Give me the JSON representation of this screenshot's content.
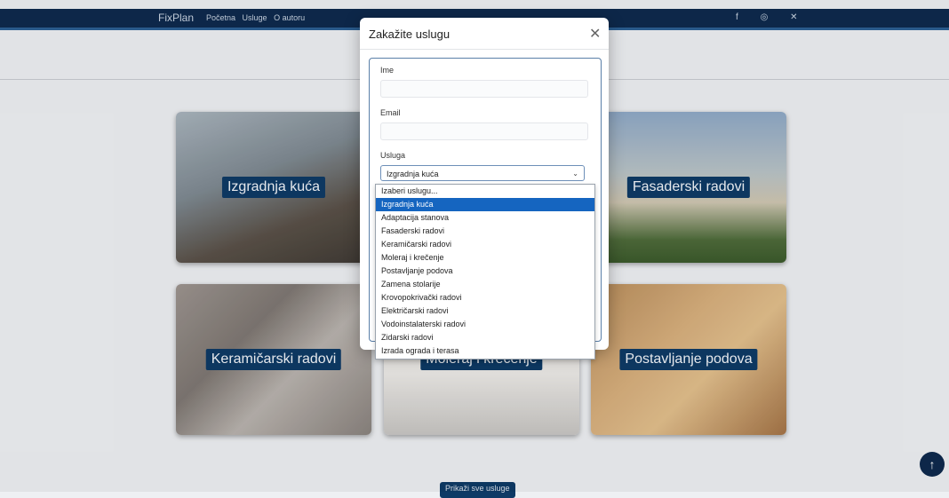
{
  "navbar": {
    "brand": "FixPlan",
    "links": [
      "Početna",
      "Usluge",
      "O autoru"
    ],
    "social_icons": [
      "facebook-icon",
      "instagram-icon",
      "x-icon"
    ]
  },
  "cards": [
    {
      "label": "Izgradnja kuća"
    },
    {
      "label": ""
    },
    {
      "label": "Fasaderski radovi"
    },
    {
      "label": "Keramičarski radovi"
    },
    {
      "label": "Moleraj i krečenje"
    },
    {
      "label": "Postavljanje podova"
    }
  ],
  "show_all_button": "Prikaži sve usluge",
  "modal": {
    "title": "Zakažite uslugu",
    "name_label": "Ime",
    "name_value": "",
    "email_label": "Email",
    "email_value": "",
    "service_label": "Usluga",
    "service_selected": "Izgradnja kuća",
    "options": [
      "Izaberi uslugu...",
      "Izgradnja kuća",
      "Adaptacija stanova",
      "Fasaderski radovi",
      "Keramičarski radovi",
      "Moleraj i krečenje",
      "Postavljanje podova",
      "Zamena stolarije",
      "Krovopokrivački radovi",
      "Električarski radovi",
      "Vodoinstalaterski radovi",
      "Zidarski radovi",
      "Izrada ograda i terasa"
    ]
  },
  "colors": {
    "navbar": "#0e2a4d",
    "accent": "#0e3a66",
    "option_highlight": "#1565c0"
  }
}
